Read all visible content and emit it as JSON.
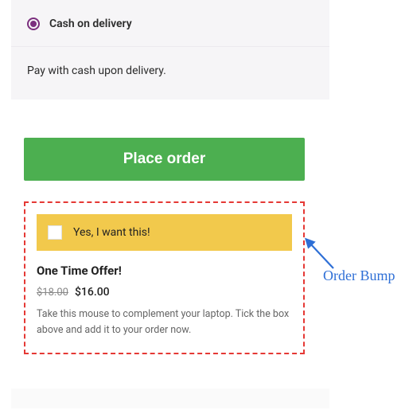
{
  "payment": {
    "method_label": "Cash on delivery",
    "description": "Pay with cash upon delivery."
  },
  "checkout": {
    "place_order_label": "Place order"
  },
  "bump": {
    "accept_label": "Yes, I want this!",
    "title": "One Time Offer!",
    "price_old": "$18.00",
    "price_new": "$16.00",
    "description": "Take this mouse to complement your laptop. Tick the box above and add it to your order now."
  },
  "annotation": {
    "label": "Order Bump"
  }
}
